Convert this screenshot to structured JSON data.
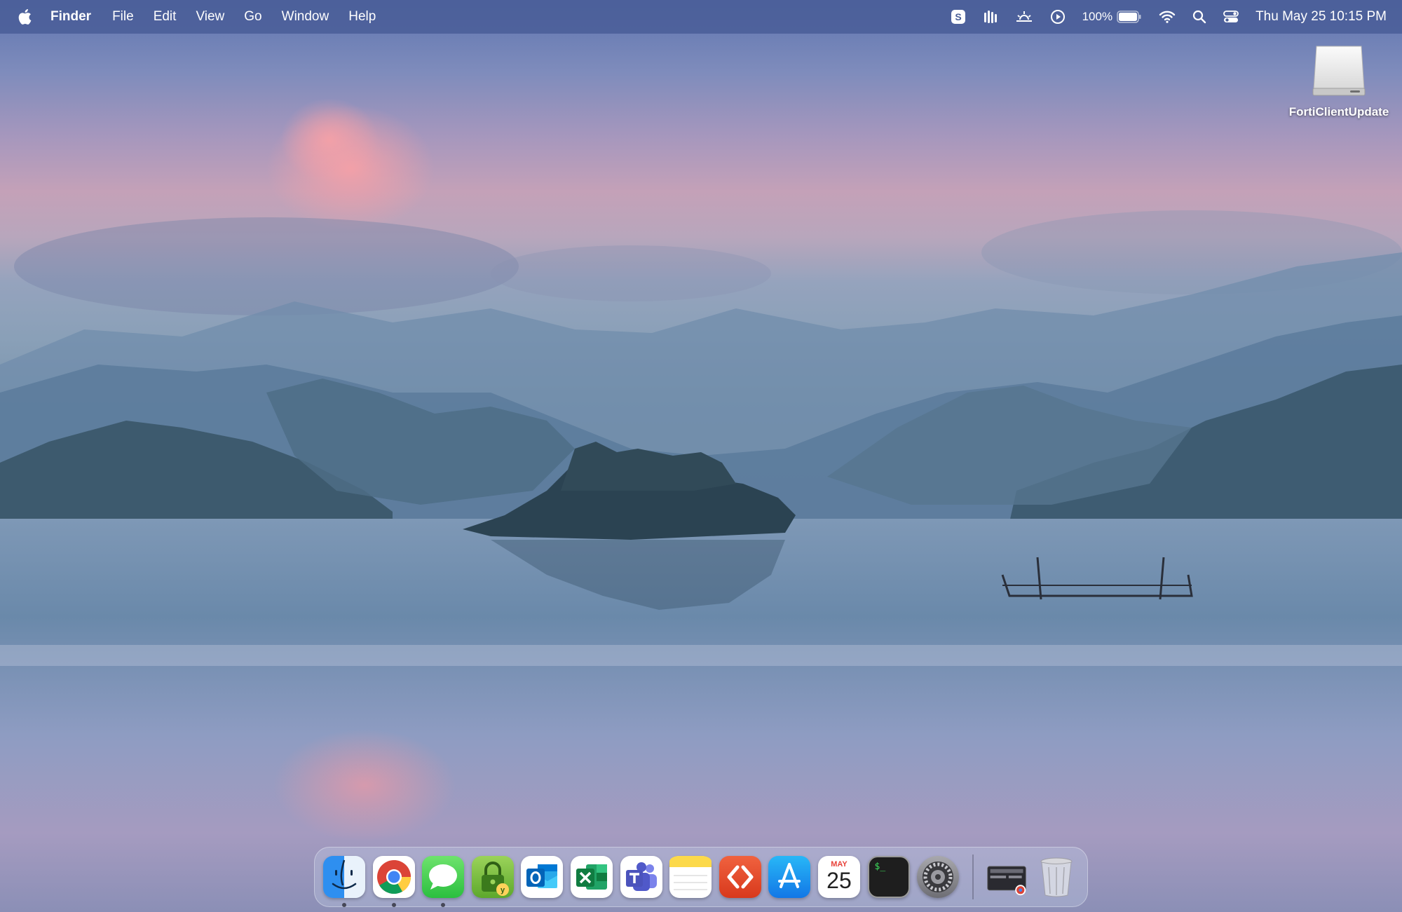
{
  "menubar": {
    "apple_icon": "apple-logo-icon",
    "app_name": "Finder",
    "menus": [
      "File",
      "Edit",
      "View",
      "Go",
      "Window",
      "Help"
    ],
    "status_icons": [
      "skype-icon",
      "audio-waveform-icon",
      "sunset-icon",
      "play-circle-icon"
    ],
    "battery_percent": "100%",
    "battery_level": 1.0,
    "right_icons": [
      "wifi-icon",
      "spotlight-search-icon",
      "control-center-icon"
    ],
    "clock": "Thu May 25  10:15 PM"
  },
  "desktop": {
    "icons": [
      {
        "label": "FortiClientUpdate",
        "icon": "disk-image-icon"
      }
    ]
  },
  "dock": {
    "apps": [
      {
        "name": "finder-icon",
        "running": true
      },
      {
        "name": "chrome-icon",
        "running": true
      },
      {
        "name": "messages-icon",
        "running": true
      },
      {
        "name": "keepass-icon",
        "running": false
      },
      {
        "name": "outlook-icon",
        "running": false
      },
      {
        "name": "excel-icon",
        "running": false
      },
      {
        "name": "teams-icon",
        "running": false
      },
      {
        "name": "notes-icon",
        "running": false
      },
      {
        "name": "remote-desktop-icon",
        "running": false
      },
      {
        "name": "app-store-icon",
        "running": false
      },
      {
        "name": "calendar-icon",
        "running": false
      },
      {
        "name": "terminal-icon",
        "running": false
      },
      {
        "name": "system-settings-icon",
        "running": false
      }
    ],
    "calendar": {
      "month": "MAY",
      "day": "25"
    },
    "terminal_prompt": "$_",
    "trailing": [
      {
        "name": "downloads-stack-icon"
      },
      {
        "name": "trash-icon"
      }
    ]
  }
}
